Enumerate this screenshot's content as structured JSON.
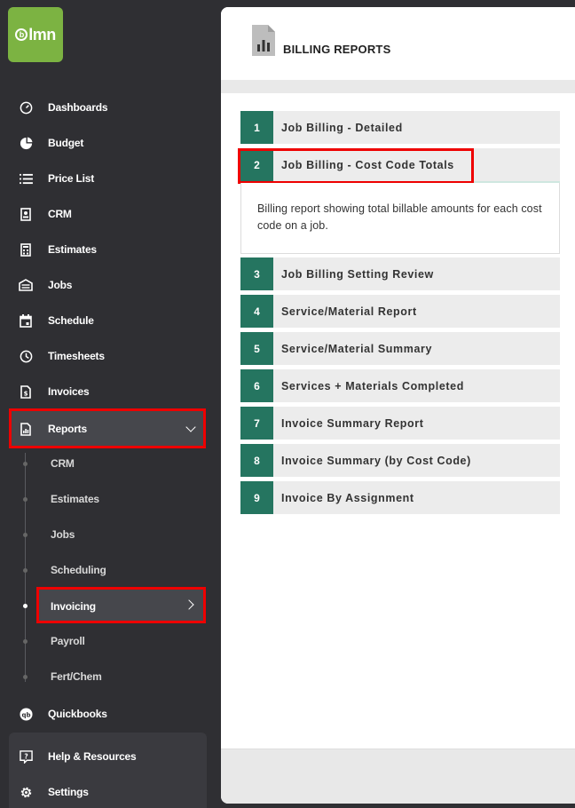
{
  "brand": {
    "logo_text": "lmn",
    "color": "#7cb342"
  },
  "sidebar": {
    "items": [
      {
        "label": "Dashboards",
        "icon": "dashboard-icon"
      },
      {
        "label": "Budget",
        "icon": "budget-icon"
      },
      {
        "label": "Price List",
        "icon": "list-icon"
      },
      {
        "label": "CRM",
        "icon": "contact-card-icon"
      },
      {
        "label": "Estimates",
        "icon": "calculator-icon"
      },
      {
        "label": "Jobs",
        "icon": "jobs-icon"
      },
      {
        "label": "Schedule",
        "icon": "calendar-icon"
      },
      {
        "label": "Timesheets",
        "icon": "clock-icon"
      },
      {
        "label": "Invoices",
        "icon": "invoice-icon"
      },
      {
        "label": "Reports",
        "icon": "report-icon"
      }
    ],
    "report_subitems": [
      {
        "label": "CRM"
      },
      {
        "label": "Estimates"
      },
      {
        "label": "Jobs"
      },
      {
        "label": "Scheduling"
      },
      {
        "label": "Invoicing"
      },
      {
        "label": "Payroll"
      },
      {
        "label": "Fert/Chem"
      }
    ],
    "quickbooks": {
      "label": "Quickbooks",
      "icon": "quickbooks-icon"
    },
    "help": {
      "label": "Help & Resources",
      "icon": "help-icon"
    },
    "settings": {
      "label": "Settings",
      "icon": "gear-icon"
    }
  },
  "main": {
    "title": "BILLING REPORTS",
    "reports": [
      {
        "num": "1",
        "label": "Job Billing - Detailed"
      },
      {
        "num": "2",
        "label": "Job Billing - Cost Code Totals"
      },
      {
        "num": "3",
        "label": "Job Billing Setting Review"
      },
      {
        "num": "4",
        "label": "Service/Material Report"
      },
      {
        "num": "5",
        "label": "Service/Material Summary"
      },
      {
        "num": "6",
        "label": "Services + Materials Completed"
      },
      {
        "num": "7",
        "label": "Invoice Summary Report"
      },
      {
        "num": "8",
        "label": "Invoice Summary (by Cost Code)"
      },
      {
        "num": "9",
        "label": "Invoice By Assignment"
      }
    ],
    "expanded_description": "Billing report showing total billable amounts for each cost code on a job."
  },
  "colors": {
    "accent_green": "#257560",
    "highlight_red": "#ee0000",
    "sidebar_bg": "#2f2f33"
  }
}
